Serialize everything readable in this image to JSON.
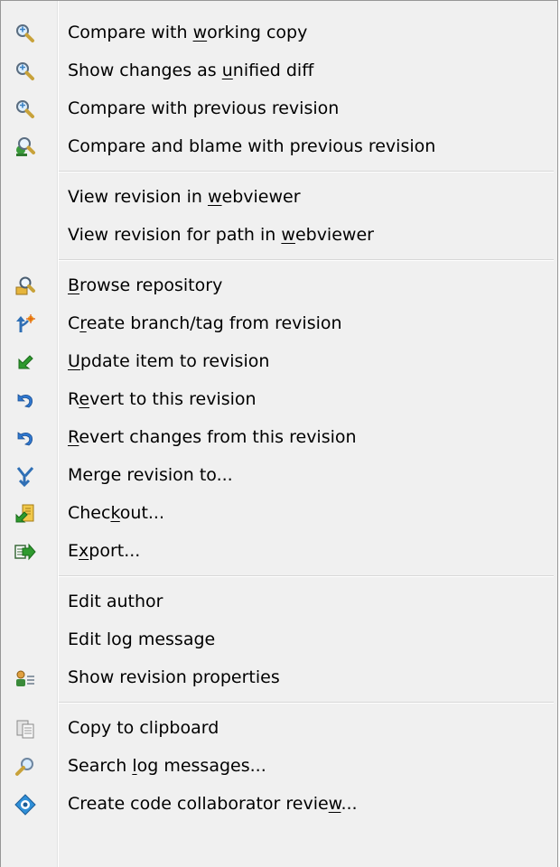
{
  "menu": {
    "groups": [
      [
        {
          "before": "Compare with ",
          "key": "w",
          "after": "orking copy",
          "icon": "magnifier-icon"
        },
        {
          "before": "Show changes as ",
          "key": "u",
          "after": "nified diff",
          "icon": "magnifier-icon"
        },
        {
          "before": "Compare with previous revision",
          "key": "",
          "after": "",
          "icon": "magnifier-icon"
        },
        {
          "before": "Compare and blame with previous revision",
          "key": "",
          "after": "",
          "icon": "blame-magnifier-icon"
        }
      ],
      [
        {
          "before": "View revision in ",
          "key": "w",
          "after": "ebviewer",
          "icon": ""
        },
        {
          "before": "View revision for path in ",
          "key": "w",
          "after": "ebviewer",
          "icon": ""
        }
      ],
      [
        {
          "before": "",
          "key": "B",
          "after": "rowse repository",
          "icon": "browse-repository-icon"
        },
        {
          "before": "C",
          "key": "r",
          "after": "eate branch/tag from revision",
          "icon": "branch-tag-icon"
        },
        {
          "before": "",
          "key": "U",
          "after": "pdate item to revision",
          "icon": "update-arrow-icon"
        },
        {
          "before": "R",
          "key": "e",
          "after": "vert to this revision",
          "icon": "revert-arrow-icon"
        },
        {
          "before": "",
          "key": "R",
          "after": "evert changes from this revision",
          "icon": "revert-arrow-icon"
        },
        {
          "before": "Merge revision to...",
          "key": "",
          "after": "",
          "icon": "merge-icon"
        },
        {
          "before": "Chec",
          "key": "k",
          "after": "out...",
          "icon": "checkout-icon"
        },
        {
          "before": "E",
          "key": "x",
          "after": "port...",
          "icon": "export-icon"
        }
      ],
      [
        {
          "before": "Edit author",
          "key": "",
          "after": "",
          "icon": ""
        },
        {
          "before": "Edit log message",
          "key": "",
          "after": "",
          "icon": ""
        },
        {
          "before": "Show revision properties",
          "key": "",
          "after": "",
          "icon": "properties-icon"
        }
      ],
      [
        {
          "before": "Copy to clipboard",
          "key": "",
          "after": "",
          "icon": "clipboard-icon"
        },
        {
          "before": "Search ",
          "key": "l",
          "after": "og messages...",
          "icon": "search-icon"
        },
        {
          "before": "Create code collaborator revie",
          "key": "w",
          "after": "...",
          "icon": "code-collaborator-icon"
        }
      ]
    ]
  },
  "colors": {
    "menu_bg": "#f0f0f0",
    "border": "#979797",
    "separator": "#d7d7d7",
    "text": "#000000"
  }
}
